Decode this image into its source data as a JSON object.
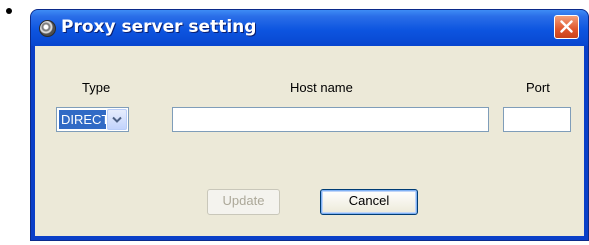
{
  "dialog": {
    "title": "Proxy server setting",
    "icon": "proxy-app-icon",
    "close_icon": "close-icon"
  },
  "form": {
    "type_label": "Type",
    "host_label": "Host name",
    "port_label": "Port",
    "type_value": "DIRECT",
    "host_value": "",
    "port_value": ""
  },
  "buttons": {
    "update_label": "Update",
    "update_enabled": false,
    "cancel_label": "Cancel"
  },
  "colors": {
    "titlebar": "#0d55e0",
    "client_bg": "#ece9d8",
    "selection": "#316ac5",
    "close_button": "#e0562c"
  }
}
